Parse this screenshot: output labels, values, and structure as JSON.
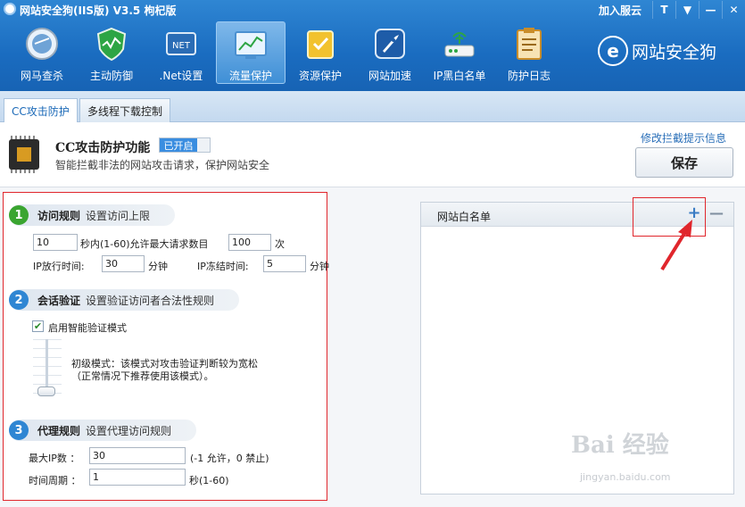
{
  "window": {
    "title": "网站安全狗(IIS版) V3.5 枸杞版",
    "qq_link": "加入服云",
    "controls": [
      "T",
      "▼",
      "—",
      "✕"
    ]
  },
  "toolbar": [
    {
      "label": "网马查杀",
      "icon": "globe-scan-icon"
    },
    {
      "label": "主动防御",
      "icon": "shield-icon"
    },
    {
      "label": ".Net设置",
      "icon": "net-icon"
    },
    {
      "label": "流量保护",
      "icon": "traffic-chart-icon",
      "active": true
    },
    {
      "label": "资源保护",
      "icon": "folder-icon"
    },
    {
      "label": "网站加速",
      "icon": "rocket-icon"
    },
    {
      "label": "IP黑白名单",
      "icon": "router-icon"
    },
    {
      "label": "防护日志",
      "icon": "clipboard-icon"
    }
  ],
  "brand": {
    "mark": "e",
    "name": "网站安全狗"
  },
  "tabs": [
    {
      "label": "CC攻击防护",
      "active": true
    },
    {
      "label": "多线程下载控制",
      "active": false
    }
  ],
  "header": {
    "title": "CC攻击防护功能",
    "status": "已开启",
    "subtitle": "智能拦截非法的网站攻击请求，保护网站安全",
    "edit_link": "修改拦截提示信息",
    "save_label": "保存"
  },
  "sections": {
    "visit": {
      "num": "1",
      "title": "访问规则",
      "desc": "设置访问上限",
      "seconds": "10",
      "seconds_label": "秒内(1-60)允许最大请求数目",
      "max_requests": "100",
      "times_unit": "次",
      "ip_release_label": "IP放行时间:",
      "ip_release": "30",
      "ip_release_unit": "分钟",
      "ip_freeze_label": "IP冻结时间:",
      "ip_freeze": "5",
      "ip_freeze_unit": "分钟"
    },
    "session": {
      "num": "2",
      "title": "会话验证",
      "desc": "设置验证访问者合法性规则",
      "checkbox_label": "启用智能验证模式",
      "checked": true,
      "mode_line1": "初级模式：该模式对攻击验证判断较为宽松",
      "mode_line2": "（正常情况下推荐使用该模式）。",
      "level": 0
    },
    "proxy": {
      "num": "3",
      "title": "代理规则",
      "desc": "设置代理访问规则",
      "max_ip_label": "最大IP数 ：",
      "max_ip": "30",
      "max_ip_hint": "(-1 允许，0 禁止)",
      "period_label": "时间周期 ：",
      "period": "1",
      "period_hint": "秒(1-60)"
    }
  },
  "whitelist": {
    "title": "网站白名单",
    "add_symbol": "+",
    "remove_symbol": "—"
  },
  "watermark": {
    "text": "Bai 经验",
    "url": "jingyan.baidu.com"
  },
  "colors": {
    "accent": "#1a6cc0",
    "highlight": "#e0262c",
    "on": "#3a8de0"
  }
}
